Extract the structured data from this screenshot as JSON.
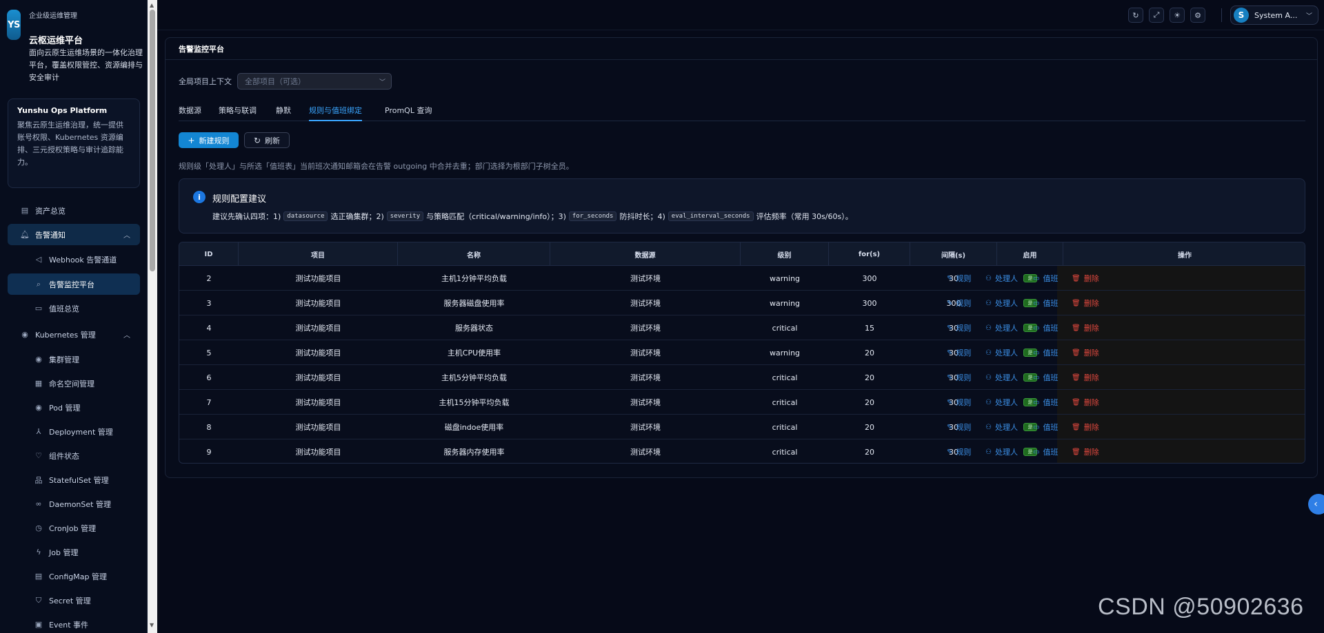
{
  "brand": {
    "logo": "YS",
    "subtitle": "企业级运维管理",
    "title": "云枢运维平台",
    "description": "面向云原生运维场景的一体化治理平台，覆盖权限管控、资源编排与安全审计"
  },
  "platform_card": {
    "title": "Yunshu Ops Platform",
    "description": "聚焦云原生运维治理，统一提供账号权限、Kubernetes 资源编排、三元授权策略与审计追踪能力。"
  },
  "sidebar": {
    "items": [
      {
        "label": "资产总览",
        "icon": "grid-icon"
      },
      {
        "label": "告警通知",
        "icon": "bell-icon"
      },
      {
        "label": "Webhook 告警通道",
        "icon": "send-icon"
      },
      {
        "label": "告警监控平台",
        "icon": "search-icon"
      },
      {
        "label": "值班总览",
        "icon": "calendar-icon"
      },
      {
        "label": "Kubernetes 管理",
        "icon": "kubernetes-icon"
      },
      {
        "label": "集群管理",
        "icon": "cluster-icon"
      },
      {
        "label": "命名空间管理",
        "icon": "namespace-icon"
      },
      {
        "label": "Pod 管理",
        "icon": "pod-icon"
      },
      {
        "label": "Deployment 管理",
        "icon": "deployment-icon"
      },
      {
        "label": "组件状态",
        "icon": "heart-icon"
      },
      {
        "label": "StatefulSet 管理",
        "icon": "statefulset-icon"
      },
      {
        "label": "DaemonSet 管理",
        "icon": "link-icon"
      },
      {
        "label": "CronJob 管理",
        "icon": "clock-icon"
      },
      {
        "label": "Job 管理",
        "icon": "lightning-icon"
      },
      {
        "label": "ConfigMap 管理",
        "icon": "file-icon"
      },
      {
        "label": "Secret 管理",
        "icon": "shield-icon"
      },
      {
        "label": "Event 事件",
        "icon": "event-icon"
      }
    ]
  },
  "topbar": {
    "user_initial": "S",
    "user_name": "System A...",
    "icons": [
      "refresh-icon",
      "fullscreen-icon",
      "bulb-icon",
      "settings-icon"
    ]
  },
  "panel": {
    "title": "告警监控平台",
    "context_label": "全局项目上下文",
    "context_placeholder": "全部项目（可选）",
    "tabs": [
      "数据源",
      "策略与联调",
      "静默",
      "规则与值班绑定",
      "PromQL 查询"
    ],
    "active_tab": "规则与值班绑定",
    "new_rule_label": "新建规则",
    "refresh_label": "刷新",
    "hint": "规则级「处理人」与所选「值班表」当前班次通知邮箱会在告警 outgoing 中合并去重；部门选择为根部门子树全员。"
  },
  "advice": {
    "title": "规则配置建议",
    "part1": "建议先确认四项：1)",
    "code1": "datasource",
    "part2": "选正确集群；2)",
    "code2": "severity",
    "part3": "与策略匹配（critical/warning/info）；3)",
    "code3": "for_seconds",
    "part4": "防抖时长；4)",
    "code4": "eval_interval_seconds",
    "part5": "评估频率（常用 30s/60s）。"
  },
  "table": {
    "headers": [
      "ID",
      "项目",
      "名称",
      "数据源",
      "级别",
      "for(s)",
      "间隔(s)",
      "启用",
      "操作"
    ],
    "enabled_badge": "是",
    "actions": {
      "rule": "规则",
      "handler": "处理人",
      "duty": "值班",
      "delete": "删除"
    },
    "rows": [
      {
        "id": "2",
        "project": "测试功能项目",
        "name": "主机1分钟平均负载",
        "datasource": "测试环境",
        "level": "warning",
        "for": "300",
        "interval": "30"
      },
      {
        "id": "3",
        "project": "测试功能项目",
        "name": "服务器磁盘使用率",
        "datasource": "测试环境",
        "level": "warning",
        "for": "300",
        "interval": "300"
      },
      {
        "id": "4",
        "project": "测试功能项目",
        "name": "服务器状态",
        "datasource": "测试环境",
        "level": "critical",
        "for": "15",
        "interval": "30"
      },
      {
        "id": "5",
        "project": "测试功能项目",
        "name": "主机CPU使用率",
        "datasource": "测试环境",
        "level": "warning",
        "for": "20",
        "interval": "30"
      },
      {
        "id": "6",
        "project": "测试功能项目",
        "name": "主机5分钟平均负载",
        "datasource": "测试环境",
        "level": "critical",
        "for": "20",
        "interval": "30"
      },
      {
        "id": "7",
        "project": "测试功能项目",
        "name": "主机15分钟平均负载",
        "datasource": "测试环境",
        "level": "critical",
        "for": "20",
        "interval": "30"
      },
      {
        "id": "8",
        "project": "测试功能项目",
        "name": "磁盘indoe使用率",
        "datasource": "测试环境",
        "level": "critical",
        "for": "20",
        "interval": "30"
      },
      {
        "id": "9",
        "project": "测试功能项目",
        "name": "服务器内存使用率",
        "datasource": "测试环境",
        "level": "critical",
        "for": "20",
        "interval": "30"
      }
    ]
  },
  "watermark": "CSDN @50902636",
  "colors": {
    "accent": "#1386d3",
    "danger": "#e0483e",
    "link": "#3b8fe6"
  }
}
